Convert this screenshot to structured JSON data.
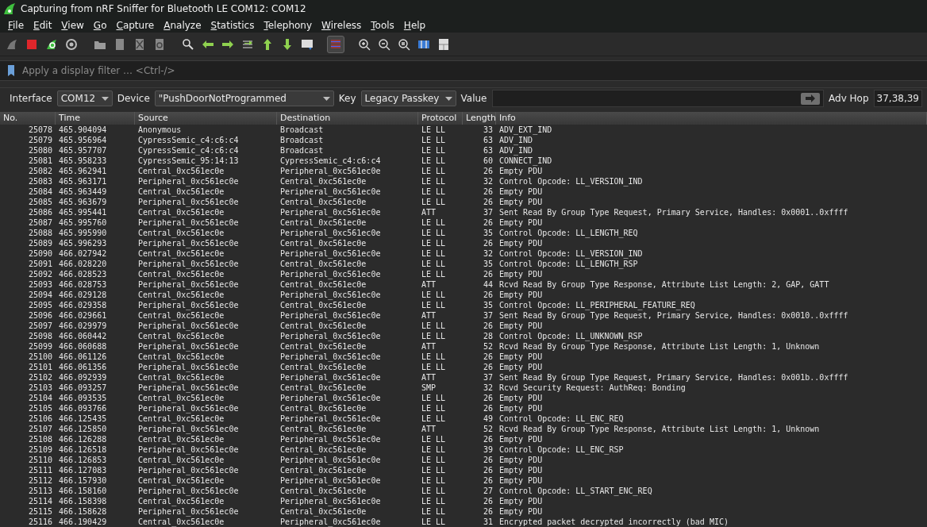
{
  "window": {
    "title": "Capturing from nRF Sniffer for Bluetooth LE COM12: COM12"
  },
  "menu": [
    "File",
    "Edit",
    "View",
    "Go",
    "Capture",
    "Analyze",
    "Statistics",
    "Telephony",
    "Wireless",
    "Tools",
    "Help"
  ],
  "filter": {
    "placeholder": "Apply a display filter … <Ctrl-/>"
  },
  "sniffer_bar": {
    "interface_label": "Interface",
    "interface": "COM12",
    "device_label": "Device",
    "device": "\"PushDoorNotProgrammed",
    "key_label": "Key",
    "key": "Legacy Passkey",
    "value_label": "Value",
    "adv_hop_label": "Adv Hop",
    "adv_hop": "37,38,39"
  },
  "table": {
    "columns": [
      "No.",
      "Time",
      "Source",
      "Destination",
      "Protocol",
      "Length",
      "Info"
    ],
    "rows": [
      [
        "25078",
        "465.904094",
        "Anonymous",
        "Broadcast",
        "LE LL",
        "33",
        "ADV_EXT_IND"
      ],
      [
        "25079",
        "465.956964",
        "CypressSemic_c4:c6:c4",
        "Broadcast",
        "LE LL",
        "63",
        "ADV_IND"
      ],
      [
        "25080",
        "465.957707",
        "CypressSemic_c4:c6:c4",
        "Broadcast",
        "LE LL",
        "63",
        "ADV_IND"
      ],
      [
        "25081",
        "465.958233",
        "CypressSemic_95:14:13",
        "CypressSemic_c4:c6:c4",
        "LE LL",
        "60",
        "CONNECT_IND"
      ],
      [
        "25082",
        "465.962941",
        "Central_0xc561ec0e",
        "Peripheral_0xc561ec0e",
        "LE LL",
        "26",
        "Empty PDU"
      ],
      [
        "25083",
        "465.963171",
        "Peripheral_0xc561ec0e",
        "Central_0xc561ec0e",
        "LE LL",
        "32",
        "Control Opcode: LL_VERSION_IND"
      ],
      [
        "25084",
        "465.963449",
        "Central_0xc561ec0e",
        "Peripheral_0xc561ec0e",
        "LE LL",
        "26",
        "Empty PDU"
      ],
      [
        "25085",
        "465.963679",
        "Peripheral_0xc561ec0e",
        "Central_0xc561ec0e",
        "LE LL",
        "26",
        "Empty PDU"
      ],
      [
        "25086",
        "465.995441",
        "Central_0xc561ec0e",
        "Peripheral_0xc561ec0e",
        "ATT",
        "37",
        "Sent Read By Group Type Request, Primary Service, Handles: 0x0001..0xffff"
      ],
      [
        "25087",
        "465.995760",
        "Peripheral_0xc561ec0e",
        "Central_0xc561ec0e",
        "LE LL",
        "26",
        "Empty PDU"
      ],
      [
        "25088",
        "465.995990",
        "Central_0xc561ec0e",
        "Peripheral_0xc561ec0e",
        "LE LL",
        "35",
        "Control Opcode: LL_LENGTH_REQ"
      ],
      [
        "25089",
        "465.996293",
        "Peripheral_0xc561ec0e",
        "Central_0xc561ec0e",
        "LE LL",
        "26",
        "Empty PDU"
      ],
      [
        "25090",
        "466.027942",
        "Central_0xc561ec0e",
        "Peripheral_0xc561ec0e",
        "LE LL",
        "32",
        "Control Opcode: LL_VERSION_IND"
      ],
      [
        "25091",
        "466.028220",
        "Peripheral_0xc561ec0e",
        "Central_0xc561ec0e",
        "LE LL",
        "35",
        "Control Opcode: LL_LENGTH_RSP"
      ],
      [
        "25092",
        "466.028523",
        "Central_0xc561ec0e",
        "Peripheral_0xc561ec0e",
        "LE LL",
        "26",
        "Empty PDU"
      ],
      [
        "25093",
        "466.028753",
        "Peripheral_0xc561ec0e",
        "Central_0xc561ec0e",
        "ATT",
        "44",
        "Rcvd Read By Group Type Response, Attribute List Length: 2, GAP, GATT"
      ],
      [
        "25094",
        "466.029128",
        "Central_0xc561ec0e",
        "Peripheral_0xc561ec0e",
        "LE LL",
        "26",
        "Empty PDU"
      ],
      [
        "25095",
        "466.029358",
        "Peripheral_0xc561ec0e",
        "Central_0xc561ec0e",
        "LE LL",
        "35",
        "Control Opcode: LL_PERIPHERAL_FEATURE_REQ"
      ],
      [
        "25096",
        "466.029661",
        "Central_0xc561ec0e",
        "Peripheral_0xc561ec0e",
        "ATT",
        "37",
        "Sent Read By Group Type Request, Primary Service, Handles: 0x0010..0xffff"
      ],
      [
        "25097",
        "466.029979",
        "Peripheral_0xc561ec0e",
        "Central_0xc561ec0e",
        "LE LL",
        "26",
        "Empty PDU"
      ],
      [
        "25098",
        "466.060442",
        "Central_0xc561ec0e",
        "Peripheral_0xc561ec0e",
        "LE LL",
        "28",
        "Control Opcode: LL_UNKNOWN_RSP"
      ],
      [
        "25099",
        "466.060688",
        "Peripheral_0xc561ec0e",
        "Central_0xc561ec0e",
        "ATT",
        "52",
        "Rcvd Read By Group Type Response, Attribute List Length: 1, Unknown"
      ],
      [
        "25100",
        "466.061126",
        "Central_0xc561ec0e",
        "Peripheral_0xc561ec0e",
        "LE LL",
        "26",
        "Empty PDU"
      ],
      [
        "25101",
        "466.061356",
        "Peripheral_0xc561ec0e",
        "Central_0xc561ec0e",
        "LE LL",
        "26",
        "Empty PDU"
      ],
      [
        "25102",
        "466.092939",
        "Central_0xc561ec0e",
        "Peripheral_0xc561ec0e",
        "ATT",
        "37",
        "Sent Read By Group Type Request, Primary Service, Handles: 0x001b..0xffff"
      ],
      [
        "25103",
        "466.093257",
        "Peripheral_0xc561ec0e",
        "Central_0xc561ec0e",
        "SMP",
        "32",
        "Rcvd Security Request: AuthReq: Bonding"
      ],
      [
        "25104",
        "466.093535",
        "Central_0xc561ec0e",
        "Peripheral_0xc561ec0e",
        "LE LL",
        "26",
        "Empty PDU"
      ],
      [
        "25105",
        "466.093766",
        "Peripheral_0xc561ec0e",
        "Central_0xc561ec0e",
        "LE LL",
        "26",
        "Empty PDU"
      ],
      [
        "25106",
        "466.125435",
        "Central_0xc561ec0e",
        "Peripheral_0xc561ec0e",
        "LE LL",
        "49",
        "Control Opcode: LL_ENC_REQ"
      ],
      [
        "25107",
        "466.125850",
        "Peripheral_0xc561ec0e",
        "Central_0xc561ec0e",
        "ATT",
        "52",
        "Rcvd Read By Group Type Response, Attribute List Length: 1, Unknown"
      ],
      [
        "25108",
        "466.126288",
        "Central_0xc561ec0e",
        "Peripheral_0xc561ec0e",
        "LE LL",
        "26",
        "Empty PDU"
      ],
      [
        "25109",
        "466.126518",
        "Peripheral_0xc561ec0e",
        "Central_0xc561ec0e",
        "LE LL",
        "39",
        "Control Opcode: LL_ENC_RSP"
      ],
      [
        "25110",
        "466.126853",
        "Central_0xc561ec0e",
        "Peripheral_0xc561ec0e",
        "LE LL",
        "26",
        "Empty PDU"
      ],
      [
        "25111",
        "466.127083",
        "Peripheral_0xc561ec0e",
        "Central_0xc561ec0e",
        "LE LL",
        "26",
        "Empty PDU"
      ],
      [
        "25112",
        "466.157930",
        "Central_0xc561ec0e",
        "Peripheral_0xc561ec0e",
        "LE LL",
        "26",
        "Empty PDU"
      ],
      [
        "25113",
        "466.158160",
        "Peripheral_0xc561ec0e",
        "Central_0xc561ec0e",
        "LE LL",
        "27",
        "Control Opcode: LL_START_ENC_REQ"
      ],
      [
        "25114",
        "466.158398",
        "Central_0xc561ec0e",
        "Peripheral_0xc561ec0e",
        "LE LL",
        "26",
        "Empty PDU"
      ],
      [
        "25115",
        "466.158628",
        "Peripheral_0xc561ec0e",
        "Central_0xc561ec0e",
        "LE LL",
        "26",
        "Empty PDU"
      ],
      [
        "25116",
        "466.190429",
        "Central_0xc561ec0e",
        "Peripheral_0xc561ec0e",
        "LE LL",
        "31",
        "Encrypted packet decrypted incorrectly (bad MIC)"
      ]
    ]
  }
}
